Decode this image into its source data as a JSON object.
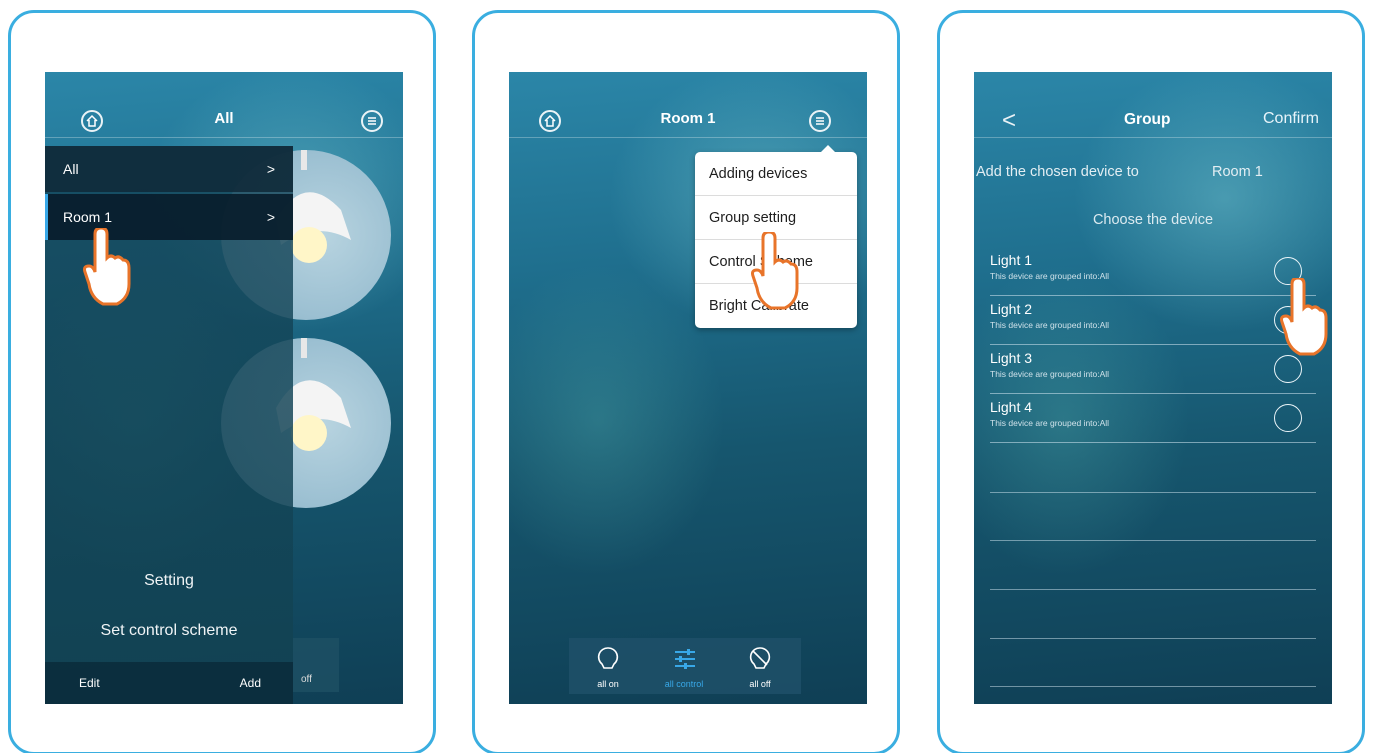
{
  "screens": [
    {
      "title": "All",
      "drawer": {
        "items": [
          {
            "label": "All",
            "chevron": ">"
          },
          {
            "label": "Room 1",
            "chevron": ">"
          }
        ],
        "setting": "Setting",
        "set_scheme": "Set control scheme",
        "edit": "Edit",
        "add": "Add"
      },
      "peek_label": "off"
    },
    {
      "title": "Room 1",
      "menu": [
        "Adding devices",
        "Group setting",
        "Control Scheme",
        "Bright Calibrate"
      ],
      "bottom_bar": [
        {
          "label": "all on",
          "icon": "bulb-icon"
        },
        {
          "label": "all control",
          "icon": "sliders-icon"
        },
        {
          "label": "all off",
          "icon": "bulb-off-icon"
        }
      ]
    },
    {
      "back": "<",
      "title": "Group",
      "confirm": "Confirm",
      "add_to": "Add the chosen device to",
      "room": "Room 1",
      "choose": "Choose the device",
      "devices": [
        {
          "name": "Light 1",
          "sub": "This device are grouped into:All"
        },
        {
          "name": "Light 2",
          "sub": "This device are grouped into:All"
        },
        {
          "name": "Light 3",
          "sub": "This device are grouped into:All"
        },
        {
          "name": "Light 4",
          "sub": "This device are grouped into:All"
        }
      ]
    }
  ],
  "colors": {
    "frame": "#3aaee0",
    "accent": "#38a8e8",
    "hand": "#e8742a"
  }
}
